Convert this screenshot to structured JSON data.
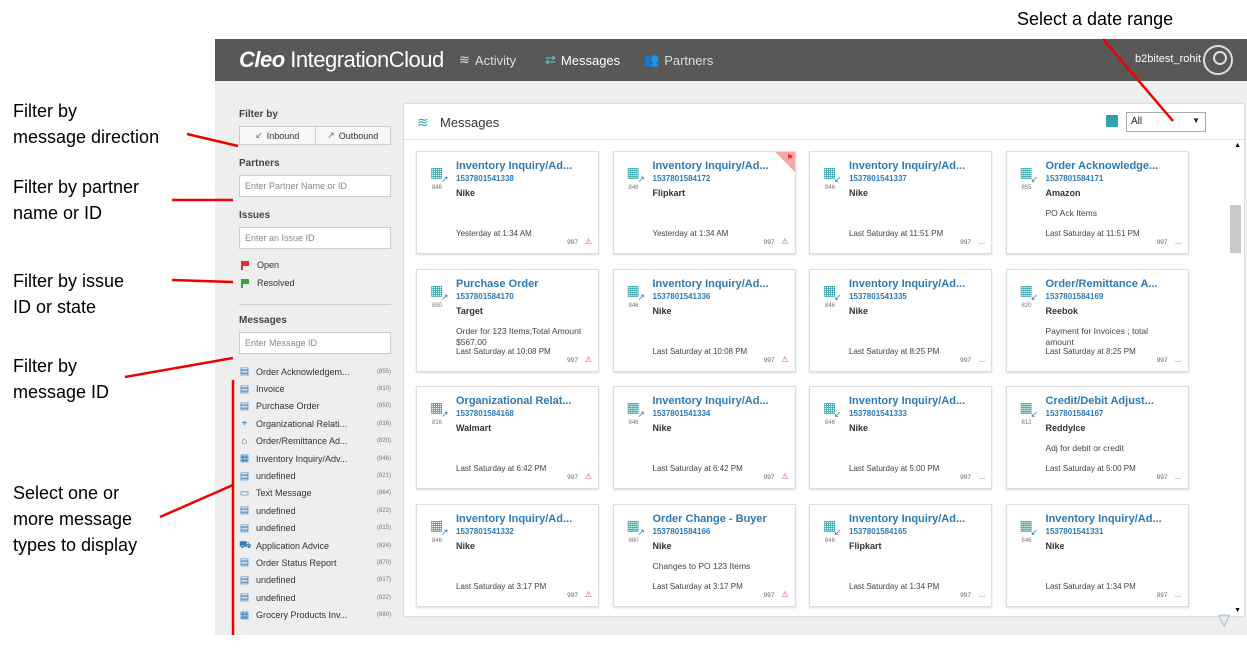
{
  "callouts": {
    "date_range": "Select a date range",
    "direction": "Filter by\nmessage direction",
    "partner": "Filter by partner\nname or ID",
    "issue": "Filter by issue\nID or state",
    "message_id": "Filter by\nmessage ID",
    "types": "Select one or\nmore message\ntypes to display"
  },
  "app": {
    "logo_bold": "Cleo",
    "logo_rest": " IntegrationCloud",
    "nav": [
      {
        "label": "Activity",
        "icon": "activity-icon"
      },
      {
        "label": "Messages",
        "icon": "messages-icon"
      },
      {
        "label": "Partners",
        "icon": "partners-icon"
      }
    ],
    "user": "b2bitest_rohit",
    "accent": "#2b7bb9",
    "teal": "#2fa3a9"
  },
  "filters": {
    "filter_by": "Filter by",
    "inbound": "Inbound",
    "outbound": "Outbound",
    "partners_heading": "Partners",
    "partner_placeholder": "Enter Partner Name or ID",
    "issues_heading": "Issues",
    "issue_placeholder": "Enter an Issue ID",
    "open": "Open",
    "resolved": "Resolved",
    "messages_heading": "Messages",
    "message_placeholder": "Enter Message ID"
  },
  "message_types": [
    {
      "label": "Order Acknowledgem...",
      "count": "(855)",
      "icon": "document-check-icon"
    },
    {
      "label": "Invoice",
      "count": "(810)",
      "icon": "document-icon"
    },
    {
      "label": "Purchase Order",
      "count": "(850)",
      "icon": "document-icon"
    },
    {
      "label": "Organizational Relati...",
      "count": "(816)",
      "icon": "location-pin-icon"
    },
    {
      "label": "Order/Remittance Ad...",
      "count": "(820)",
      "icon": "bank-icon"
    },
    {
      "label": "Inventory Inquiry/Adv...",
      "count": "(846)",
      "icon": "warehouse-icon"
    },
    {
      "label": "undefined",
      "count": "(821)",
      "icon": "document-icon"
    },
    {
      "label": "Text Message",
      "count": "(864)",
      "icon": "chat-icon"
    },
    {
      "label": "undefined",
      "count": "(823)",
      "icon": "document-icon"
    },
    {
      "label": "undefined",
      "count": "(815)",
      "icon": "document-icon"
    },
    {
      "label": "Application Advice",
      "count": "(824)",
      "icon": "truck-icon"
    },
    {
      "label": "Order Status Report",
      "count": "(870)",
      "icon": "status-report-icon"
    },
    {
      "label": "undefined",
      "count": "(817)",
      "icon": "document-icon"
    },
    {
      "label": "undefined",
      "count": "(822)",
      "icon": "document-icon"
    },
    {
      "label": "Grocery Products Inv...",
      "count": "(880)",
      "icon": "grocery-icon"
    }
  ],
  "panel": {
    "title": "Messages",
    "date_range_value": "All"
  },
  "cards": [
    {
      "title": "Inventory Inquiry/Ad...",
      "id": "1537801541338",
      "code": "846",
      "partner": "Nike",
      "desc": "",
      "time": "Yesterday at 1:34 AM",
      "ack": "997",
      "dir": "out",
      "flag": false,
      "status": "error"
    },
    {
      "title": "Inventory Inquiry/Ad...",
      "id": "1537801584172",
      "code": "846",
      "partner": "Flipkart",
      "desc": "",
      "time": "Yesterday at 1:34 AM",
      "ack": "997",
      "dir": "out",
      "flag": true,
      "status": "error"
    },
    {
      "title": "Inventory Inquiry/Ad...",
      "id": "1537801541337",
      "code": "846",
      "partner": "Nike",
      "desc": "",
      "time": "Last Saturday at 11:51 PM",
      "ack": "997",
      "dir": "in",
      "flag": false,
      "status": "ok"
    },
    {
      "title": "Order Acknowledge...",
      "id": "1537801584171",
      "code": "855",
      "partner": "Amazon",
      "desc": "PO Ack Items",
      "time": "Last Saturday at 11:51 PM",
      "ack": "997",
      "dir": "in",
      "flag": false,
      "status": "ok"
    },
    {
      "title": "Purchase Order",
      "id": "1537801584170",
      "code": "850",
      "partner": "Target",
      "desc": "Order for 123 Items;Total Amount $567.00",
      "time": "Last Saturday at 10:08 PM",
      "ack": "997",
      "dir": "out",
      "flag": false,
      "status": "error"
    },
    {
      "title": "Inventory Inquiry/Ad...",
      "id": "1537801541336",
      "code": "846",
      "partner": "Nike",
      "desc": "",
      "time": "Last Saturday at 10:08 PM",
      "ack": "997",
      "dir": "out",
      "flag": false,
      "status": "error"
    },
    {
      "title": "Inventory Inquiry/Ad...",
      "id": "1537801541335",
      "code": "846",
      "partner": "Nike",
      "desc": "",
      "time": "Last Saturday at 8:25 PM",
      "ack": "997",
      "dir": "in",
      "flag": false,
      "status": "ok"
    },
    {
      "title": "Order/Remittance A...",
      "id": "1537801584169",
      "code": "820",
      "partner": "Reebok",
      "desc": "Payment for Invoices ; total amount",
      "time": "Last Saturday at 8:25 PM",
      "ack": "997",
      "dir": "in",
      "flag": false,
      "status": "ok"
    },
    {
      "title": "Organizational Relat...",
      "id": "1537801584168",
      "code": "816",
      "partner": "Walmart",
      "desc": "",
      "time": "Last Saturday at 6:42 PM",
      "ack": "997",
      "dir": "out",
      "flag": false,
      "status": "error"
    },
    {
      "title": "Inventory Inquiry/Ad...",
      "id": "1537801541334",
      "code": "846",
      "partner": "Nike",
      "desc": "",
      "time": "Last Saturday at 6:42 PM",
      "ack": "997",
      "dir": "out",
      "flag": false,
      "status": "error"
    },
    {
      "title": "Inventory Inquiry/Ad...",
      "id": "1537801541333",
      "code": "846",
      "partner": "Nike",
      "desc": "",
      "time": "Last Saturday at 5:00 PM",
      "ack": "997",
      "dir": "in",
      "flag": false,
      "status": "ok"
    },
    {
      "title": "Credit/Debit Adjust...",
      "id": "1537801584167",
      "code": "812",
      "partner": "ReddyIce",
      "desc": "Adj for debit or credit",
      "time": "Last Saturday at 5:00 PM",
      "ack": "997",
      "dir": "in",
      "flag": false,
      "status": "ok"
    },
    {
      "title": "Inventory Inquiry/Ad...",
      "id": "1537801541332",
      "code": "846",
      "partner": "Nike",
      "desc": "",
      "time": "Last Saturday at 3:17 PM",
      "ack": "997",
      "dir": "out",
      "flag": false,
      "status": "error"
    },
    {
      "title": "Order Change - Buyer",
      "id": "1537801584166",
      "code": "860",
      "partner": "Nike",
      "desc": "Changes to PO 123 Items",
      "time": "Last Saturday at 3:17 PM",
      "ack": "997",
      "dir": "out",
      "flag": false,
      "status": "error"
    },
    {
      "title": "Inventory Inquiry/Ad...",
      "id": "1537801584165",
      "code": "846",
      "partner": "Flipkart",
      "desc": "",
      "time": "Last Saturday at 1:34 PM",
      "ack": "997",
      "dir": "in",
      "flag": false,
      "status": "ok"
    },
    {
      "title": "Inventory Inquiry/Ad...",
      "id": "1537801541331",
      "code": "846",
      "partner": "Nike",
      "desc": "",
      "time": "Last Saturday at 1:34 PM",
      "ack": "997",
      "dir": "in",
      "flag": false,
      "status": "ok"
    }
  ]
}
